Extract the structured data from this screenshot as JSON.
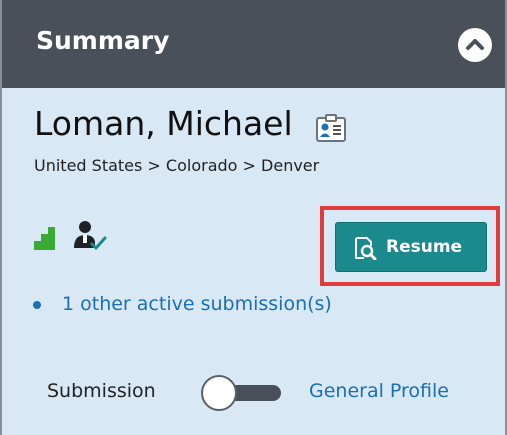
{
  "header": {
    "title": "Summary",
    "collapse_icon": "chevron-up-icon"
  },
  "candidate": {
    "name": "Loman, Michael",
    "vcard_icon": "vcard-icon",
    "location": "United States > Colorado > Denver"
  },
  "status_icons": {
    "level_icon": "level-bars-icon",
    "person_icon": "person-check-icon"
  },
  "resume_button": {
    "label": "Resume",
    "icon": "document-search-icon"
  },
  "submissions": {
    "link_text": "1 other active submission(s)"
  },
  "view_toggle": {
    "left_label": "Submission",
    "right_label": "General Profile"
  },
  "colors": {
    "header_bg": "#4a505a",
    "panel_bg": "#d9e8f5",
    "accent_teal": "#1a8a8c",
    "link_blue": "#1a6fb5",
    "highlight_red": "#e23b3b",
    "level_green": "#3aaa35"
  }
}
